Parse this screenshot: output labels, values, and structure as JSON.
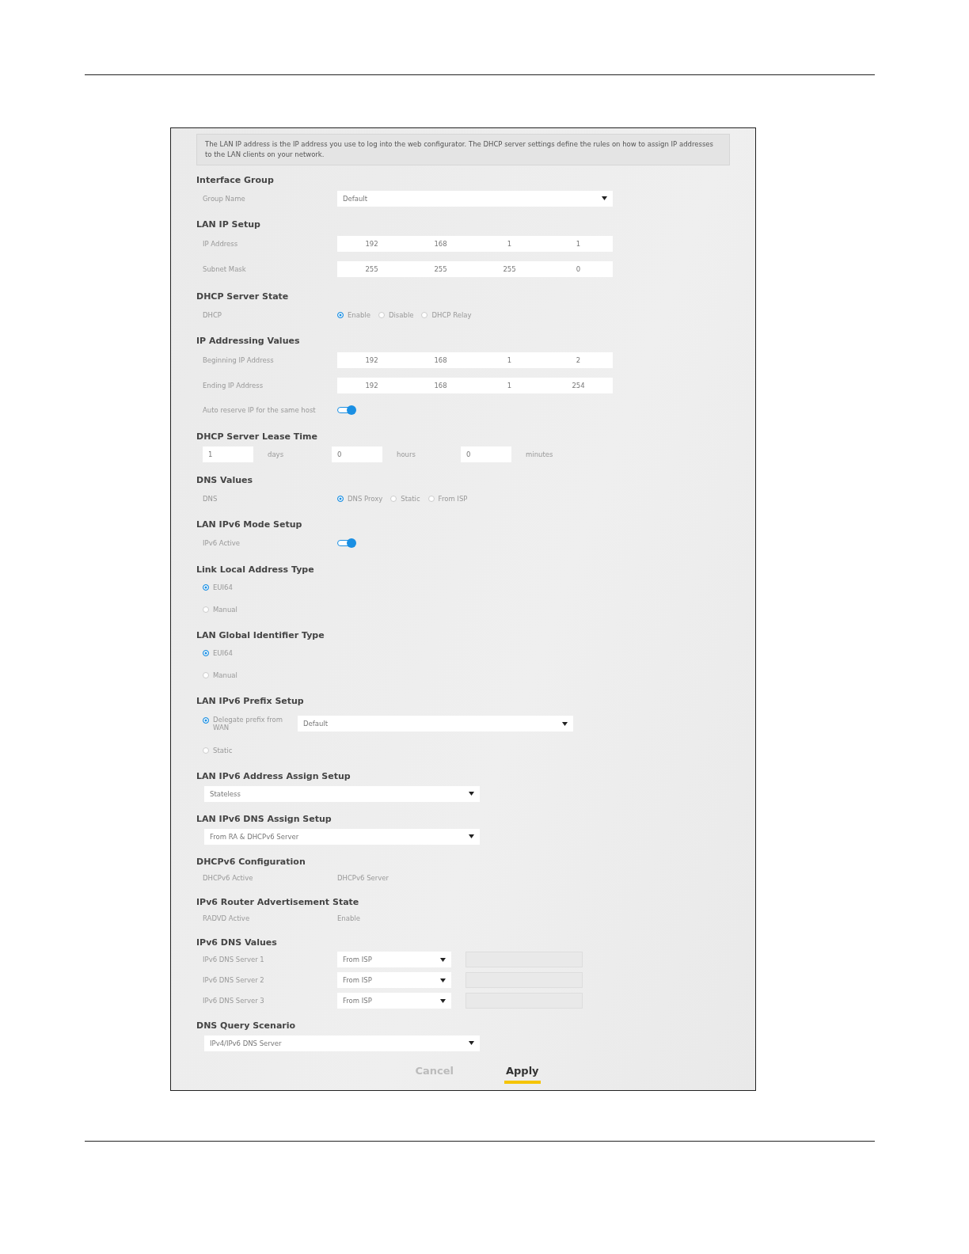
{
  "intro": "The LAN IP address is the IP address you use to log into the web configurator. The DHCP server settings define the rules on how to assign IP addresses to the LAN clients on your network.",
  "sections": [
    {
      "title": "Interface Group",
      "rows": [
        {
          "kind": "select",
          "label": "Group Name",
          "value": "Default"
        }
      ]
    },
    {
      "title": "LAN IP Setup",
      "rows": [
        {
          "kind": "ip",
          "label": "IP Address",
          "octets": [
            "192",
            "168",
            "1",
            "1"
          ]
        },
        {
          "kind": "ip",
          "label": "Subnet Mask",
          "octets": [
            "255",
            "255",
            "255",
            "0"
          ]
        }
      ]
    },
    {
      "title": "DHCP Server State",
      "rows": [
        {
          "kind": "radio_group",
          "label": "DHCP",
          "options": [
            {
              "label": "Enable",
              "selected": true
            },
            {
              "label": "Disable",
              "selected": false
            },
            {
              "label": "DHCP Relay",
              "selected": false
            }
          ]
        }
      ]
    },
    {
      "title": "IP Addressing Values",
      "rows": [
        {
          "kind": "ip",
          "label": "Beginning IP Address",
          "octets": [
            "192",
            "168",
            "1",
            "2"
          ]
        },
        {
          "kind": "ip",
          "label": "Ending IP Address",
          "octets": [
            "192",
            "168",
            "1",
            "254"
          ]
        },
        {
          "kind": "toggle",
          "label": "Auto reserve IP for the same host",
          "on": true
        }
      ]
    },
    {
      "title": "DHCP Server Lease Time",
      "rows": [
        {
          "kind": "lease",
          "fields": [
            {
              "value": "1",
              "unit": "days"
            },
            {
              "value": "0",
              "unit": "hours"
            },
            {
              "value": "0",
              "unit": "minutes"
            }
          ]
        }
      ]
    },
    {
      "title": "DNS Values",
      "rows": [
        {
          "kind": "radio_group",
          "label": "DNS",
          "options": [
            {
              "label": "DNS Proxy",
              "selected": true
            },
            {
              "label": "Static",
              "selected": false
            },
            {
              "label": "From ISP",
              "selected": false
            }
          ]
        }
      ]
    },
    {
      "title": "LAN IPv6 Mode Setup",
      "rows": [
        {
          "kind": "toggle",
          "label": "IPv6 Active",
          "on": true
        }
      ]
    },
    {
      "title": "Link Local Address Type",
      "rows": [
        {
          "kind": "radio",
          "label": "EUI64",
          "selected": true
        },
        {
          "kind": "radio",
          "label": "Manual",
          "selected": false
        }
      ]
    },
    {
      "title": "LAN Global Identifier Type",
      "rows": [
        {
          "kind": "radio",
          "label": "EUI64",
          "selected": true
        },
        {
          "kind": "radio",
          "label": "Manual",
          "selected": false
        }
      ]
    },
    {
      "title": "LAN IPv6 Prefix Setup",
      "rows": [
        {
          "kind": "radio_select",
          "label": "Delegate prefix from WAN",
          "selected": true,
          "value": "Default"
        },
        {
          "kind": "radio",
          "label": "Static",
          "selected": false
        }
      ]
    },
    {
      "title": "LAN IPv6 Address Assign Setup",
      "rows": [
        {
          "kind": "select_full",
          "value": "Stateless"
        }
      ]
    },
    {
      "title": "LAN IPv6 DNS Assign Setup",
      "rows": [
        {
          "kind": "select_full",
          "value": "From RA & DHCPv6 Server"
        }
      ]
    },
    {
      "title": "DHCPv6 Configuration",
      "rows": [
        {
          "kind": "text",
          "label": "DHCPv6 Active",
          "value": "DHCPv6 Server"
        }
      ]
    },
    {
      "title": "IPv6 Router Advertisement State",
      "rows": [
        {
          "kind": "text",
          "label": "RADVD Active",
          "value": "Enable"
        }
      ]
    },
    {
      "title": "IPv6 DNS Values",
      "rows": [
        {
          "kind": "dns_server",
          "label": "IPv6 DNS Server 1",
          "value": "From ISP"
        },
        {
          "kind": "dns_server",
          "label": "IPv6 DNS Server 2",
          "value": "From ISP"
        },
        {
          "kind": "dns_server",
          "label": "IPv6 DNS Server 3",
          "value": "From ISP"
        }
      ]
    },
    {
      "title": "DNS Query Scenario",
      "rows": [
        {
          "kind": "select_full",
          "value": "IPv4/IPv6 DNS Server"
        }
      ]
    }
  ],
  "buttons": [
    {
      "label": "Cancel",
      "kind": "secondary"
    },
    {
      "label": "Apply",
      "kind": "primary"
    }
  ]
}
